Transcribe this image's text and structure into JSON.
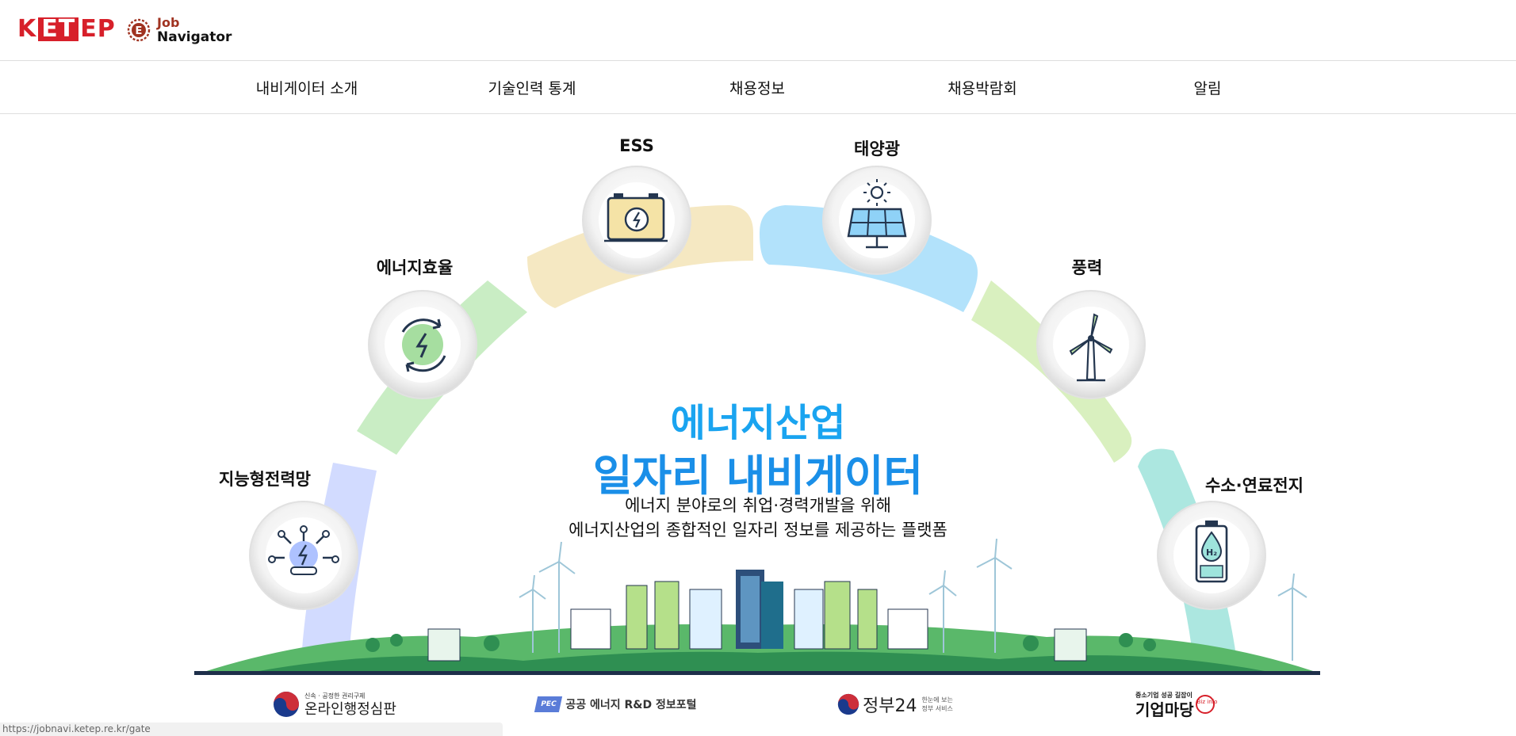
{
  "header": {
    "ketep_logo": "KETEP",
    "jobnav_logo": {
      "line1": "Job",
      "line2": "Navigator"
    }
  },
  "nav": {
    "items": [
      "내비게이터 소개",
      "기술인력 통계",
      "채용정보",
      "채용박람회",
      "알림"
    ]
  },
  "hero": {
    "categories": [
      "지능형전력망",
      "에너지효율",
      "ESS",
      "태양광",
      "풍력",
      "수소·연료전지"
    ],
    "title_line1": "에너지산업",
    "title_line2": "일자리 내비게이터",
    "subtitle_line1": "에너지 분야로의 취업·경력개발을 위해",
    "subtitle_line2": "에너지산업의 종합적인 일자리 정보를 제공하는 플랫폼"
  },
  "footer": {
    "logos": [
      {
        "small": "신속 · 공정한 권리구제",
        "main": "온라인행정심판"
      },
      {
        "badge": "PEC",
        "main": "공공 에너지 R&D 정보포털"
      },
      {
        "main": "정부24",
        "small1": "한눈에 보는",
        "small2": "정부 서비스"
      },
      {
        "small": "중소기업 성공 길잡이",
        "main": "기업마당",
        "badge": "Biz info"
      }
    ]
  },
  "status_url": "https://jobnavi.ketep.re.kr/gate",
  "colors": {
    "brand_red": "#d7202a",
    "title_blue": "#1aa4f0",
    "arc_smartgrid": "#cfd8ff",
    "arc_efficiency": "#c6ecc1",
    "arc_ess": "#f4e7bf",
    "arc_solar": "#aee0fb",
    "arc_wind": "#d7efbb",
    "arc_hydrogen": "#a9e6df"
  },
  "icons": [
    "ketep-logo",
    "navigator-compass-icon",
    "smart-grid-icon",
    "energy-efficiency-icon",
    "ess-battery-icon",
    "solar-panel-icon",
    "wind-turbine-icon",
    "hydrogen-fuel-cell-icon",
    "city-illustration"
  ]
}
